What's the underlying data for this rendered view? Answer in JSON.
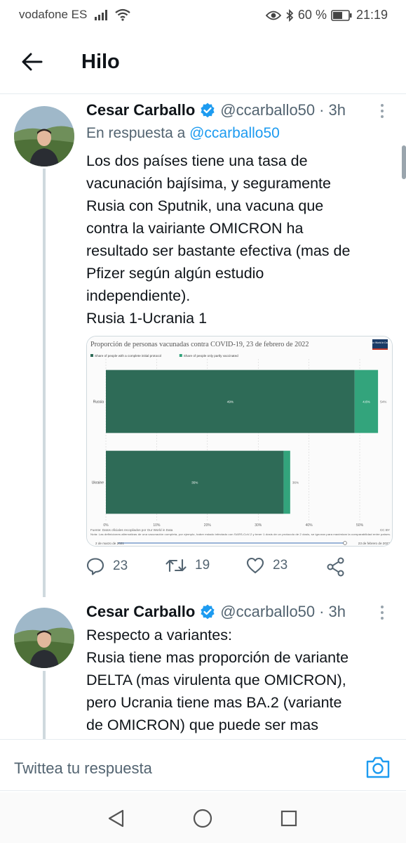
{
  "status_bar": {
    "carrier": "vodafone ES",
    "battery_percent": "60 %",
    "time": "21:19"
  },
  "header": {
    "title": "Hilo"
  },
  "tweets": [
    {
      "name": "Cesar Carballo",
      "handle": "@ccarballo50",
      "separator": "·",
      "time": "3h",
      "reply_prefix": "En respuesta a",
      "reply_handle": "@ccarballo50",
      "lines": [
        "Los dos países tiene una tasa de",
        "vacunación bajísima, y seguramente",
        "Rusia con Sputnik, una vacuna que",
        "contra la vairiante OMICRON ha",
        "resultado ser bastante efectiva (mas de",
        "Pfizer según algún estudio",
        "independiente).",
        "Rusia 1-Ucrania 1"
      ],
      "replies": "23",
      "retweets": "19",
      "likes": "23"
    },
    {
      "name": "Cesar Carballo",
      "handle": "@ccarballo50",
      "separator": "·",
      "time": "3h",
      "lines": [
        "Respecto a variantes:",
        "Rusia tiene mas proporción de variante",
        "DELTA (mas virulenta que OMICRON),",
        "pero Ucrania tiene mas BA.2 (variante",
        "de OMICRON) que puede ser mas"
      ]
    }
  ],
  "chart_data": {
    "type": "bar",
    "orientation": "horizontal",
    "stacked": true,
    "title": "Proporción de personas vacunadas contra COVID-19, 23 de febrero de 2022",
    "logo_text": "Our World in Data",
    "categories": [
      "Russia",
      "Ukraine"
    ],
    "series": [
      {
        "name": "Share of people with a complete initial protocol",
        "values": [
          49,
          35
        ],
        "labels": [
          "49%",
          "35%"
        ],
        "color": "#2e6b57"
      },
      {
        "name": "Share of people only partly vaccinated",
        "values": [
          4.6,
          1.3
        ],
        "labels": [
          "4.6%",
          ""
        ],
        "color": "#33a47c"
      }
    ],
    "total_labels": [
      "54%",
      "36%"
    ],
    "x_ticks": [
      "0%",
      "10%",
      "20%",
      "30%",
      "40%",
      "50%"
    ],
    "xlim": [
      0,
      54
    ],
    "source_line": "Fuente: Datos oficiales recopilados por Our World in Data",
    "note_line": "Nota: Las definiciones alternativas de una vacunación completa, por ejemplo, haber estado infectado con SARS-CoV-2 y tener 1 dosis de un protocolo de 2 dosis, se ignoran para maximizar la comparabilidad entre países.",
    "license": "CC BY",
    "timeline_start": "2 de marzo de 2021",
    "timeline_end": "23 de febrero de 2022"
  },
  "reply_bar": {
    "placeholder": "Twittea tu respuesta"
  },
  "icons": {
    "accent": "#1d9bf0",
    "verified_color": "#1d9bf0"
  }
}
